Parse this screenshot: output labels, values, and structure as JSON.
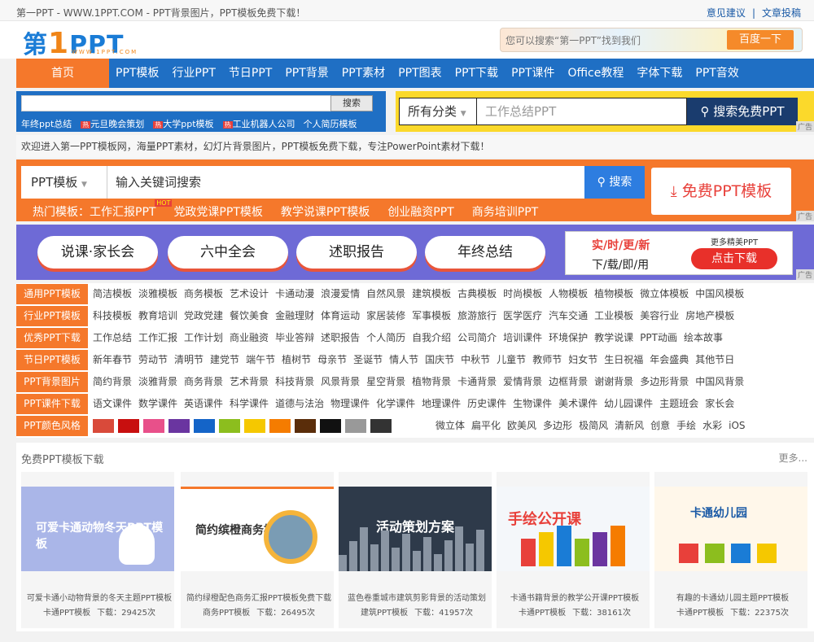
{
  "topbar": {
    "left": "第一PPT - WWW.1PPT.COM - PPT背景图片，PPT模板免费下载！",
    "feedback": "意见建议",
    "sep": "|",
    "submit": "文章投稿"
  },
  "logo": {
    "text_a": "第",
    "text_one": "1",
    "text_b": "PPT",
    "sub": "WWW.1PPT.COM"
  },
  "header_search": {
    "placeholder": "您可以搜索“第一PPT”找到我们",
    "button": "百度一下"
  },
  "nav": {
    "home": "首页",
    "items": [
      "PPT模板",
      "行业PPT",
      "节日PPT",
      "PPT背景",
      "PPT素材",
      "PPT图表",
      "PPT下载",
      "PPT课件",
      "Office教程",
      "字体下载",
      "PPT音效"
    ]
  },
  "bar2": {
    "search_button": "搜索",
    "hot": [
      "年终ppt总结",
      "元旦晚会策划",
      "大学ppt模板",
      "工业机器人公司",
      "个人简历模板"
    ],
    "hot_badge": "热",
    "category": "所有分类",
    "keyword_placeholder": "工作总结PPT",
    "go": "搜索免费PPT",
    "ad": "广告"
  },
  "welcome": "欢迎进入第一PPT模板网，海量PPT素材，幻灯片背景图片，PPT模板免费下载，专注PowerPoint素材下载！",
  "orange": {
    "select": "PPT模板",
    "keyword": "输入关键词搜索",
    "go": "搜索",
    "free": "免费PPT模板",
    "hot_label": "热门模板：",
    "hot": [
      "工作汇报PPT",
      "党政党课PPT模板",
      "教学说课PPT模板",
      "创业融资PPT",
      "商务培训PPT"
    ],
    "hot_badge": "HOT",
    "ad": "广告"
  },
  "purple": {
    "pills": [
      "说课·家长会",
      "六中全会",
      "述职报告",
      "年终总结"
    ],
    "promo_a": "实/时/更/新",
    "promo_b": "下/载/即/用",
    "promo_c": "更多精美PPT",
    "promo_d": "点击下载",
    "ad": "广告"
  },
  "categories": [
    {
      "head": "通用PPT模板",
      "items": [
        "简洁模板",
        "淡雅模板",
        "商务模板",
        "艺术设计",
        "卡通动漫",
        "浪漫爱情",
        "自然风景",
        "建筑模板",
        "古典模板",
        "时尚模板",
        "人物模板",
        "植物模板",
        "微立体模板",
        "中国风模板"
      ]
    },
    {
      "head": "行业PPT模板",
      "items": [
        "科技模板",
        "教育培训",
        "党政党建",
        "餐饮美食",
        "金融理财",
        "体育运动",
        "家居装修",
        "军事模板",
        "旅游旅行",
        "医学医疗",
        "汽车交通",
        "工业模板",
        "美容行业",
        "房地产模板"
      ]
    },
    {
      "head": "优秀PPT下载",
      "items": [
        "工作总结",
        "工作汇报",
        "工作计划",
        "商业融资",
        "毕业答辩",
        "述职报告",
        "个人简历",
        "自我介绍",
        "公司简介",
        "培训课件",
        "环境保护",
        "教学说课",
        "PPT动画",
        "绘本故事"
      ]
    },
    {
      "head": "节日PPT模板",
      "items": [
        "新年春节",
        "劳动节",
        "清明节",
        "建党节",
        "端午节",
        "植树节",
        "母亲节",
        "圣诞节",
        "情人节",
        "国庆节",
        "中秋节",
        "儿童节",
        "教师节",
        "妇女节",
        "生日祝福",
        "年会盛典",
        "其他节日"
      ]
    },
    {
      "head": "PPT背景图片",
      "items": [
        "简约背景",
        "淡雅背景",
        "商务背景",
        "艺术背景",
        "科技背景",
        "风景背景",
        "星空背景",
        "植物背景",
        "卡通背景",
        "爱情背景",
        "边框背景",
        "谢谢背景",
        "多边形背景",
        "中国风背景"
      ]
    },
    {
      "head": "PPT课件下载",
      "items": [
        "语文课件",
        "数学课件",
        "英语课件",
        "科学课件",
        "道德与法治",
        "物理课件",
        "化学课件",
        "地理课件",
        "历史课件",
        "生物课件",
        "美术课件",
        "幼儿园课件",
        "主题班会",
        "家长会"
      ]
    },
    {
      "head": "PPT颜色风格",
      "items": [
        "微立体",
        "扁平化",
        "欧美风",
        "多边形",
        "极简风",
        "清新风",
        "创意",
        "手绘",
        "水彩",
        "iOS"
      ]
    }
  ],
  "swatches": [
    "#d94a3a",
    "#c80f0f",
    "#e8508a",
    "#6a35a0",
    "#1464c8",
    "#8cbe1e",
    "#f5c800",
    "#f57c00",
    "#5a2d0a",
    "#111111",
    "#999999",
    "#333333",
    "#ffffff"
  ],
  "free_section": {
    "title": "免费PPT模板下载",
    "more": "更多..."
  },
  "cards": [
    {
      "img_title": "可爱卡通动物冬天PPT模板",
      "name": "可爱卡通小动物背景的冬天主题PPT模板",
      "cat": "卡通PPT模板",
      "dl": "下载：29425次",
      "bg": "#aab6e8"
    },
    {
      "img_title": "简约缤橙商务模板",
      "name": "简约绿橙配色商务汇报PPT模板免费下载",
      "cat": "商务PPT模板",
      "dl": "下载：26495次",
      "bg": "#ffffff"
    },
    {
      "img_title": "活动策划方案",
      "name": "蓝色卷重城市建筑剪影背景的活动策划",
      "cat": "建筑PPT模板",
      "dl": "下载：41957次",
      "bg": "#2e3a4a"
    },
    {
      "img_title": "手绘公开课",
      "name": "卡通书籍背景的教学公开课PPT模板",
      "cat": "卡通PPT模板",
      "dl": "下载：38161次",
      "bg": "#f4f7fa"
    },
    {
      "img_title": "卡通幼儿园",
      "name": "有趣的卡通幼儿园主题PPT模板",
      "cat": "卡通PPT模板",
      "dl": "下载：22375次",
      "bg": "#fff7ea"
    }
  ]
}
